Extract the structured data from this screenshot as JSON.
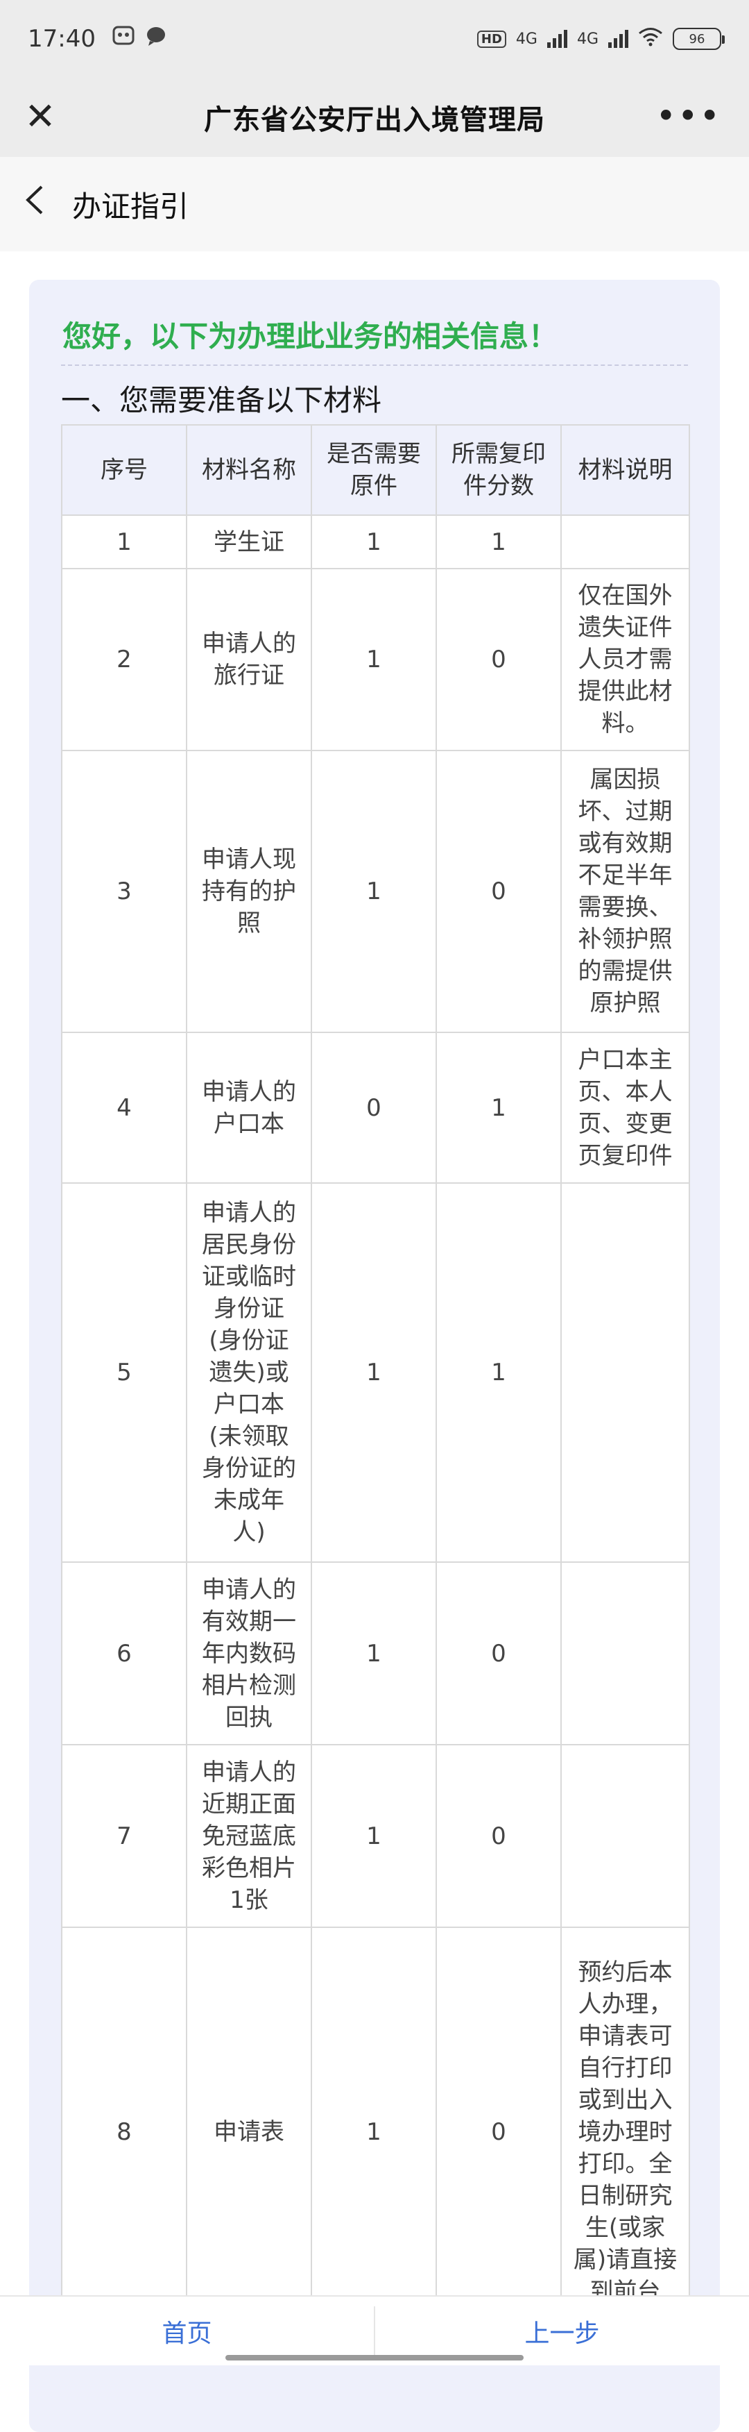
{
  "status_bar": {
    "time": "17:40",
    "hd": "HD",
    "net1": "4G",
    "net2": "4G",
    "battery": "96"
  },
  "title_bar": {
    "title": "广东省公安厅出入境管理局"
  },
  "sub_header": {
    "label": "办证指引"
  },
  "content": {
    "greeting": "您好，以下为办理此业务的相关信息！",
    "section_title": "一、您需要准备以下材料",
    "table": {
      "headers": [
        "序号",
        "材料名称",
        "是否需要原件",
        "所需复印件分数",
        "材料说明"
      ],
      "rows": [
        {
          "no": "1",
          "name": "学生证",
          "original": "1",
          "copies": "1",
          "note": ""
        },
        {
          "no": "2",
          "name": "申请人的旅行证",
          "original": "1",
          "copies": "0",
          "note": "仅在国外遗失证件人员才需提供此材料。"
        },
        {
          "no": "3",
          "name": "申请人现持有的护照",
          "original": "1",
          "copies": "0",
          "note": "属因损坏、过期或有效期不足半年需要换、补领护照的需提供原护照"
        },
        {
          "no": "4",
          "name": "申请人的户口本",
          "original": "0",
          "copies": "1",
          "note": "户口本主页、本人页、变更页复印件"
        },
        {
          "no": "5",
          "name": "申请人的居民身份证或临时身份证(身份证遗失)或户口本(未领取身份证的未成年人)",
          "original": "1",
          "copies": "1",
          "note": ""
        },
        {
          "no": "6",
          "name": "申请人的有效期一年内数码相片检测回执",
          "original": "1",
          "copies": "0",
          "note": ""
        },
        {
          "no": "7",
          "name": "申请人的近期正面免冠蓝底彩色相片1张",
          "original": "1",
          "copies": "0",
          "note": ""
        },
        {
          "no": "8",
          "name": "申请表",
          "original": "1",
          "copies": "0",
          "note": "预约后本人办理，申请表可自行打印或到出入境办理时打印。全日制研究生(或家属)请直接到前台"
        }
      ]
    }
  },
  "bottom_bar": {
    "home_label": "首页",
    "prev_label": "上一步"
  },
  "colors": {
    "greeting": "#2fae4f",
    "link": "#3a6fd6",
    "card_bg": "#eef0fb"
  }
}
